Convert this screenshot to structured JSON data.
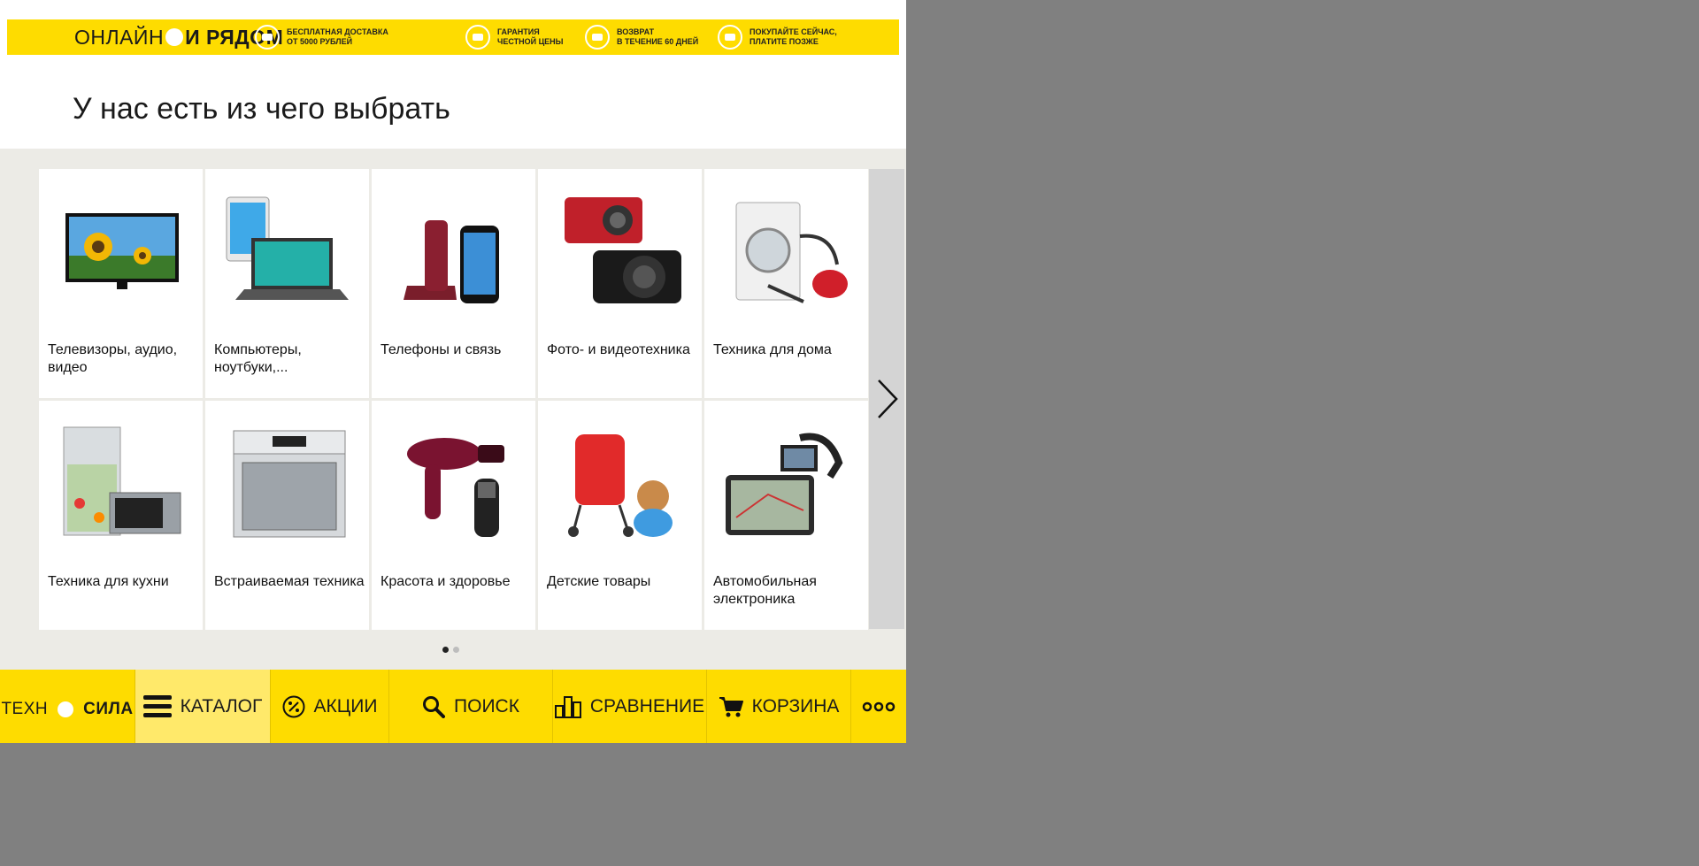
{
  "promo": {
    "brand_left": "ОНЛАЙН",
    "brand_right": "И РЯДОМ",
    "features": [
      {
        "icon": "truck-icon",
        "text": "БЕСПЛАТНАЯ ДОСТАВКА\nОТ 5000 РУБЛЕЙ"
      },
      {
        "icon": "price-tag-icon",
        "text": "ГАРАНТИЯ\nЧЕСТНОЙ ЦЕНЫ"
      },
      {
        "icon": "return-icon",
        "text": "ВОЗВРАТ\nВ ТЕЧЕНИЕ 60 ДНЕЙ"
      },
      {
        "icon": "credit-icon",
        "text": "ПОКУПАЙТЕ СЕЙЧАС,\nПЛАТИТЕ ПОЗЖЕ"
      }
    ]
  },
  "heading": "У нас есть из чего выбрать",
  "categories": [
    {
      "label": "Телевизоры, аудио, видео",
      "icon": "tv-icon"
    },
    {
      "label": "Компьютеры, ноутбуки,...",
      "icon": "laptop-tablet-icon"
    },
    {
      "label": "Телефоны и связь",
      "icon": "phone-icon"
    },
    {
      "label": "Фото- и видеотехника",
      "icon": "camera-icon"
    },
    {
      "label": "Техника для дома",
      "icon": "washing-machine-icon"
    },
    {
      "label": "Техника для кухни",
      "icon": "fridge-microwave-icon"
    },
    {
      "label": "Встраиваемая техника",
      "icon": "oven-icon"
    },
    {
      "label": "Красота и здоровье",
      "icon": "hairdryer-shaver-icon"
    },
    {
      "label": "Детские товары",
      "icon": "stroller-toy-icon"
    },
    {
      "label": "Автомобильная электроника",
      "icon": "car-navigator-icon"
    }
  ],
  "pager": {
    "pages": 2,
    "active": 1
  },
  "bottom_nav": {
    "logo_left": "ТЕХН",
    "logo_right": "СИЛА",
    "items": [
      {
        "label": "КАТАЛОГ",
        "icon": "menu-icon",
        "active": true
      },
      {
        "label": "АКЦИИ",
        "icon": "percent-icon",
        "active": false
      },
      {
        "label": "ПОИСК",
        "icon": "search-icon",
        "active": false
      },
      {
        "label": "СРАВНЕНИЕ",
        "icon": "compare-icon",
        "active": false
      },
      {
        "label": "КОРЗИНА",
        "icon": "cart-icon",
        "active": false
      },
      {
        "label": "",
        "icon": "more-icon",
        "active": false
      }
    ]
  },
  "colors": {
    "brand_yellow": "#fedc00",
    "catalog_bg": "#ecebe6",
    "page_bg": "#808080"
  }
}
